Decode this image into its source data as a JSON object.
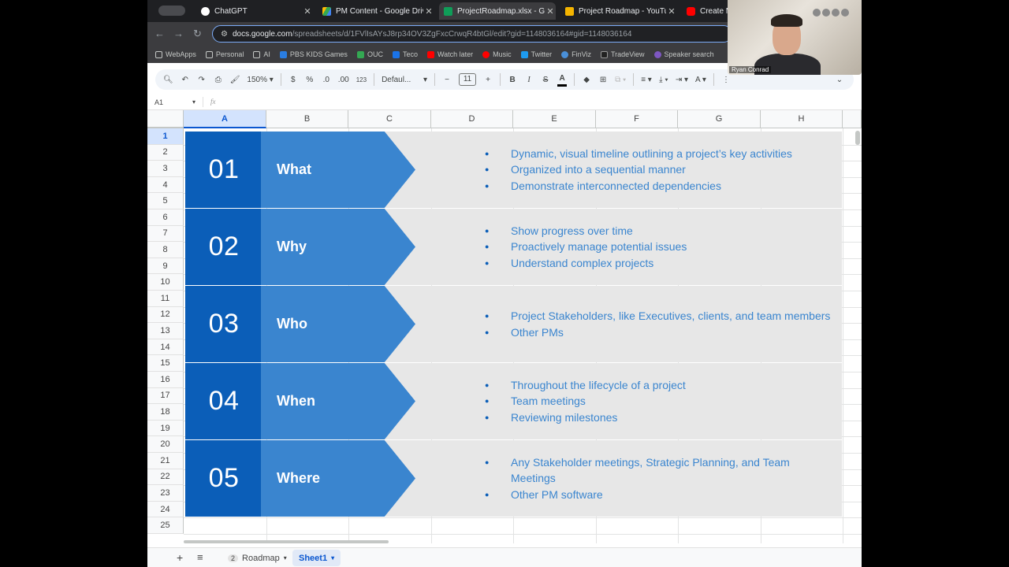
{
  "browser": {
    "tabs": [
      {
        "title": "ChatGPT",
        "color": "#ffffff"
      },
      {
        "title": "PM Content - Google Drive",
        "color": "#34a853"
      },
      {
        "title": "ProjectRoadmap.xlsx - Goo",
        "color": "#0f9d58"
      },
      {
        "title": "Project Roadmap - YouTub",
        "color": "#f4b400"
      },
      {
        "title": "Create Mu",
        "color": "#ff0000"
      }
    ],
    "url_host": "docs.google.com",
    "url_path": "/spreadsheets/d/1FVlIsAYsJ8rp34OV3ZgFxcCrwqR4btGl/edit?gid=1148036164#gid=1148036164",
    "bookmarks": [
      "WebApps",
      "Personal",
      "AI",
      "PBS KIDS Games",
      "OUC",
      "Teco",
      "Watch later",
      "Music",
      "Twitter",
      "FinViz",
      "TradeView",
      "Speaker search"
    ]
  },
  "toolbar": {
    "zoom": "150%",
    "currency": "$",
    "percent": "%",
    "dec_decrease": ".0",
    "dec_increase": ".00",
    "number_format": "123",
    "font": "Defaul...",
    "font_size": "11",
    "bold": "B",
    "italic": "I",
    "strike": "S",
    "text_color": "A"
  },
  "formula_bar": {
    "cell_ref": "A1",
    "fx": "fx"
  },
  "grid": {
    "columns": [
      "A",
      "B",
      "C",
      "D",
      "E",
      "F",
      "G",
      "H"
    ],
    "rows": [
      "1",
      "2",
      "3",
      "4",
      "5",
      "6",
      "7",
      "8",
      "9",
      "10",
      "11",
      "12",
      "13",
      "14",
      "15",
      "16",
      "17",
      "18",
      "19",
      "20",
      "21",
      "22",
      "23",
      "24",
      "25"
    ],
    "selected_cell": "A1"
  },
  "roadmap": [
    {
      "num": "01",
      "label": "What",
      "bullets": [
        "Dynamic, visual timeline outlining a project’s key activities",
        "Organized into a sequential manner",
        "Demonstrate interconnected dependencies"
      ]
    },
    {
      "num": "02",
      "label": "Why",
      "bullets": [
        "Show progress over time",
        "Proactively manage potential issues",
        "Understand complex projects"
      ]
    },
    {
      "num": "03",
      "label": "Who",
      "bullets": [
        "Project Stakeholders, like Executives, clients, and team members",
        "Other PMs"
      ]
    },
    {
      "num": "04",
      "label": "When",
      "bullets": [
        "Throughout the lifecycle of a project",
        "Team meetings",
        "Reviewing milestones"
      ]
    },
    {
      "num": "05",
      "label": "Where",
      "bullets": [
        "Any Stakeholder meetings, Strategic Planning, and Team Meetings",
        "Other PM software"
      ]
    }
  ],
  "sheets": {
    "add": "+",
    "menu": "≡",
    "tabs": [
      {
        "badge": "2",
        "name": "Roadmap",
        "active": false
      },
      {
        "badge": "",
        "name": "Sheet1",
        "active": true
      }
    ]
  },
  "webcam": {
    "name": "Ryan Conrad"
  },
  "colors": {
    "dark_blue": "#0b5eb8",
    "mid_blue": "#3a85cf",
    "band_gray": "#e7e7e7"
  }
}
